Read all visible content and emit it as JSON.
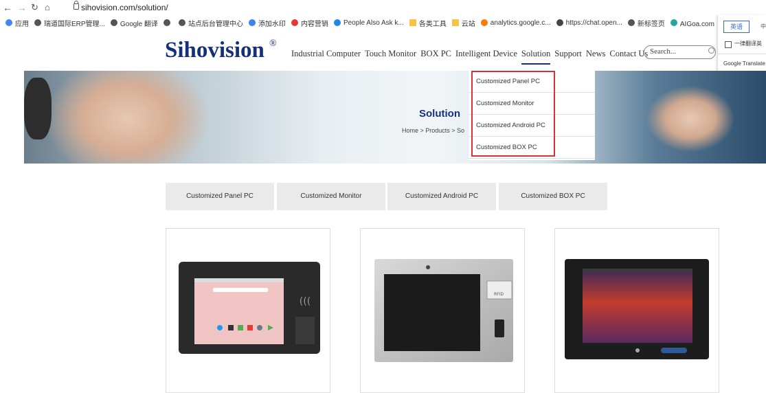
{
  "browser": {
    "url": "sihovision.com/solution/",
    "bookmarks": [
      {
        "label": "应用",
        "icon": "apps-grid-icon",
        "color": "#4285f4"
      },
      {
        "label": "瑞道国际ERP管理...",
        "icon": "globe-icon",
        "color": "#555555"
      },
      {
        "label": "Google 翻译",
        "icon": "globe-icon",
        "color": "#555555"
      },
      {
        "label": "",
        "icon": "globe-icon",
        "color": "#555555"
      },
      {
        "label": "站点后台管理中心",
        "icon": "globe-icon",
        "color": "#555555"
      },
      {
        "label": "添加水印",
        "icon": "heart-icon",
        "color": "#3b82f6"
      },
      {
        "label": "内容营销",
        "icon": "circle-icon",
        "color": "#e53935"
      },
      {
        "label": "People Also Ask k...",
        "icon": "circle-icon",
        "color": "#1e88e5"
      },
      {
        "label": "各类工具",
        "icon": "folder-icon",
        "color": "#f6c342"
      },
      {
        "label": "云站",
        "icon": "folder-icon",
        "color": "#f6c342"
      },
      {
        "label": "analytics.google.c...",
        "icon": "analytics-icon",
        "color": "#f57c00"
      },
      {
        "label": "https://chat.open...",
        "icon": "chatgpt-icon",
        "color": "#444444"
      },
      {
        "label": "新标签页",
        "icon": "globe-icon",
        "color": "#555555"
      },
      {
        "label": "AIGoa.com - AI聚...",
        "icon": "circle-icon",
        "color": "#26a69a"
      }
    ]
  },
  "translate": {
    "language": "英语",
    "more": "中",
    "always_label": "一律翻译英",
    "footer": "Google Translate"
  },
  "site": {
    "logo": "Sihovision",
    "logo_mark": "®",
    "nav": [
      "Industrial Computer",
      "Touch Monitor",
      "BOX PC",
      "Intelligent Device",
      "Solution",
      "Support",
      "News",
      "Contact Us"
    ],
    "active_nav": "Solution",
    "search_placeholder": "Search..."
  },
  "banner": {
    "title": "Solution",
    "breadcrumb": "Home > Products > So"
  },
  "dropdown": [
    "Customized Panel PC",
    "Customized Monitor",
    "Customized Android PC",
    "Customized BOX PC"
  ],
  "tabs": [
    "Customized Panel PC",
    "Customized Monitor",
    "Customized Android PC",
    "Customized BOX PC"
  ],
  "products": [
    {
      "name": "android-panel-pc-nfc"
    },
    {
      "name": "stainless-panel-pc-rfid",
      "badge": "RFID"
    },
    {
      "name": "panel-pc-black"
    }
  ],
  "colors": {
    "brand": "#14307a",
    "highlight": "#d43333"
  }
}
